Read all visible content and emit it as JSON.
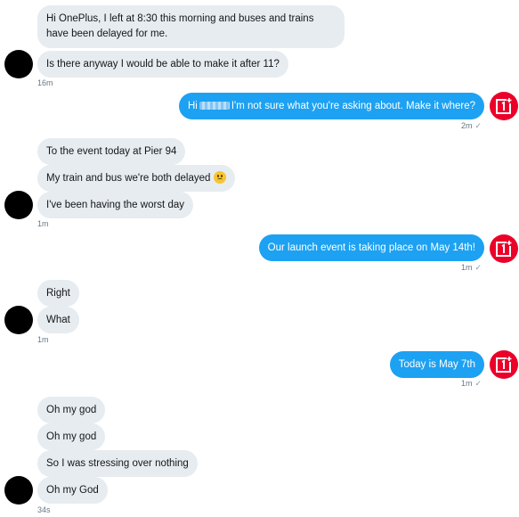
{
  "conversation": {
    "brand_color": "#eb0029",
    "outgoing_color": "#1da1f2",
    "incoming_color": "#e6ecf0",
    "messages": [
      {
        "id": "m1",
        "text": "Hi OnePlus, I left at 8:30 this morning and buses and trains have been delayed for me."
      },
      {
        "id": "m2",
        "text": "Is there anyway I would be able to make it after 11?"
      },
      {
        "id": "m3_prefix",
        "text": "Hi"
      },
      {
        "id": "m3_suffix",
        "text": "I'm not sure what you're asking about. Make it where?"
      },
      {
        "id": "m4",
        "text": "To the event today at Pier 94"
      },
      {
        "id": "m5",
        "text": "My train and bus we're both delayed"
      },
      {
        "id": "m6",
        "text": "I've been having the worst day"
      },
      {
        "id": "m7",
        "text": "Our launch event is taking place on May 14th!"
      },
      {
        "id": "m8",
        "text": "Right"
      },
      {
        "id": "m9",
        "text": "What"
      },
      {
        "id": "m10",
        "text": "Today is May 7th"
      },
      {
        "id": "m11",
        "text": "Oh my god"
      },
      {
        "id": "m12",
        "text": "Oh my god"
      },
      {
        "id": "m13",
        "text": "So I was stressing over nothing"
      },
      {
        "id": "m14",
        "text": "Oh my God"
      }
    ],
    "timestamps": {
      "t1": "16m",
      "t2": "2m",
      "t3": "1m",
      "t4": "1m",
      "t5": "1m",
      "t6": "1m",
      "t7": "34s"
    },
    "read_mark": "✓",
    "icons": {
      "user_avatar": "avatar-circle",
      "brand_avatar": "oneplus-logo-icon",
      "sad_emoji": "frowning-face-emoji"
    }
  }
}
